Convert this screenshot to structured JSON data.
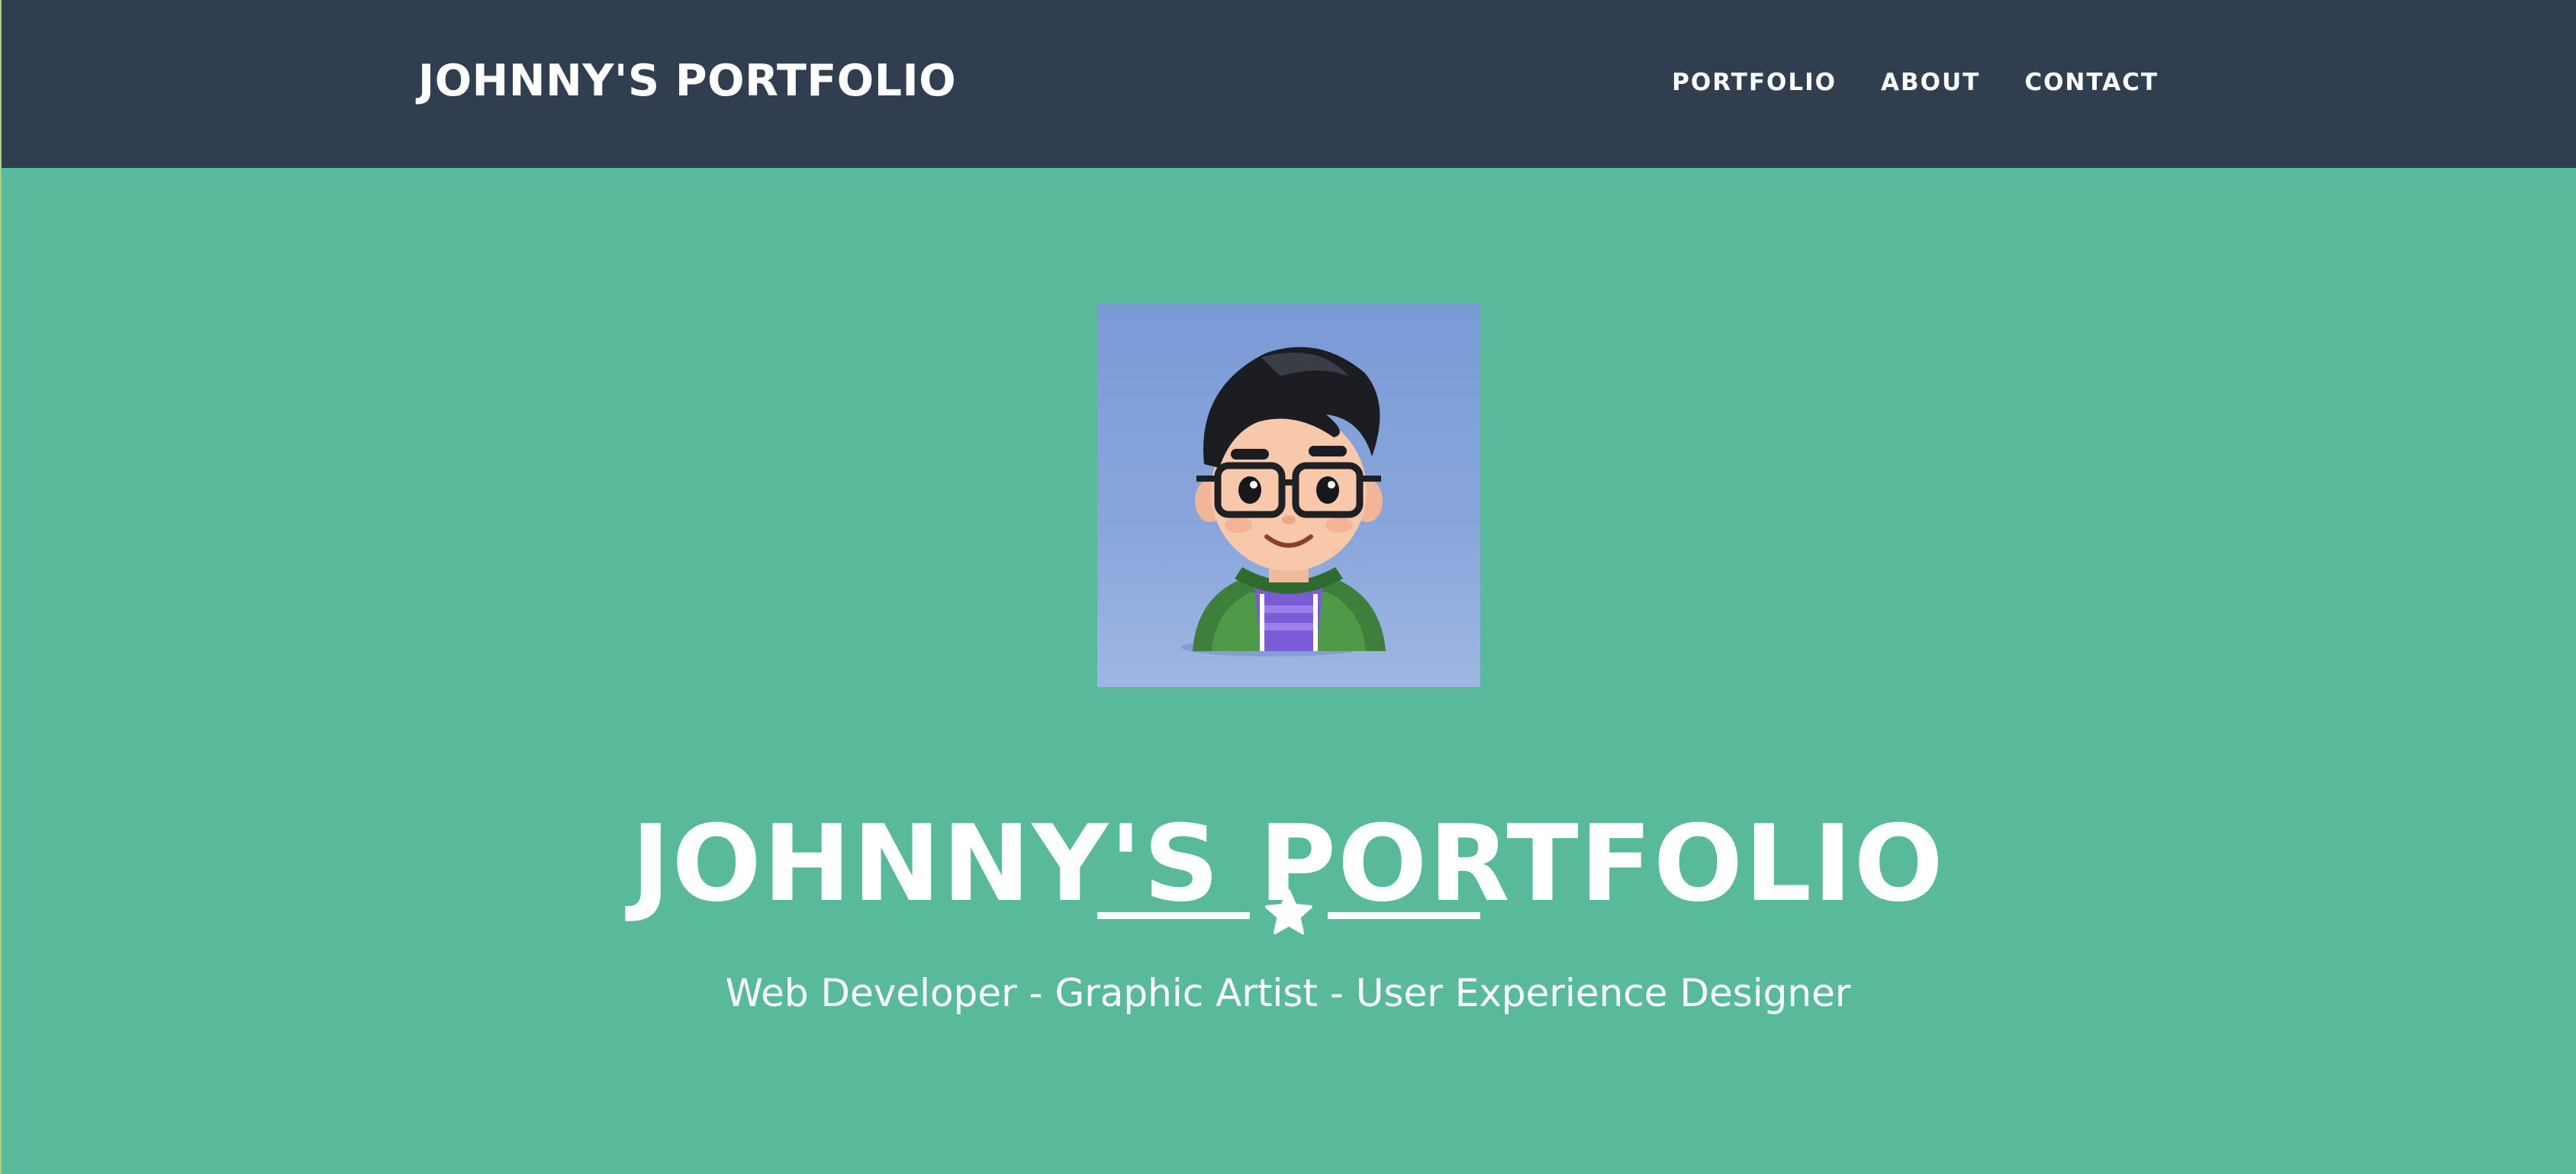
{
  "navbar": {
    "brand": "JOHNNY'S PORTFOLIO",
    "links": [
      {
        "label": "PORTFOLIO"
      },
      {
        "label": "ABOUT"
      },
      {
        "label": "CONTACT"
      }
    ]
  },
  "hero": {
    "avatar": "avatar-illustration",
    "title": "JOHNNY'S PORTFOLIO",
    "divider_icon": "star-icon",
    "subtitle": "Web Developer - Graphic Artist - User Experience Designer"
  },
  "colors": {
    "navbar_bg": "#303e50",
    "hero_bg": "#59b99b",
    "text": "#ffffff",
    "avatar_bg": "#7a9ad6"
  }
}
